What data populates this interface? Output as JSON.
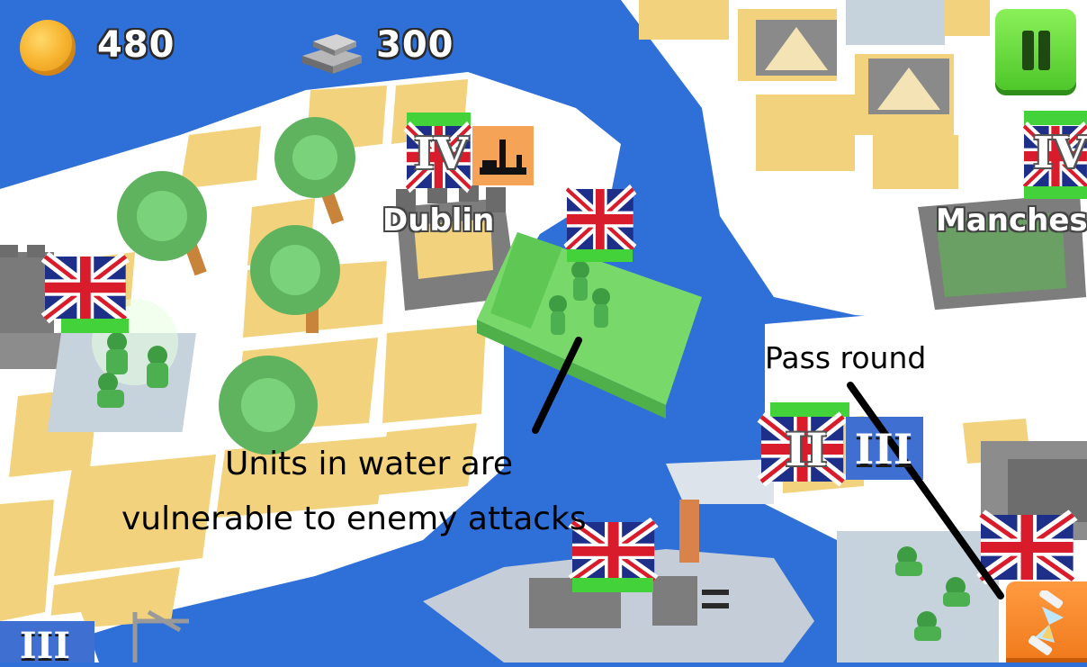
{
  "hud": {
    "coins": "480",
    "iron": "300",
    "pause_icon": "pause-icon",
    "pass_round_icon": "hourglass-icon"
  },
  "cities": {
    "dublin": "Dublin",
    "manchester": "Manches"
  },
  "unit_badges": {
    "dublin_rank": "IV",
    "manchester_rank": "IV",
    "center_rank": "II",
    "center_right_rank": "III",
    "bottom_left_rank": "III"
  },
  "annotations": {
    "water_line1": "Units in water are",
    "water_line2": "vulnerable to enemy attacks",
    "pass_round": "Pass round"
  },
  "colors": {
    "water": "#2f6fd8",
    "land": "#ffffff",
    "field": "#f2d27c",
    "selected": "#7ee06a",
    "pause": "#5bd431",
    "pass_round": "#f5831f"
  }
}
